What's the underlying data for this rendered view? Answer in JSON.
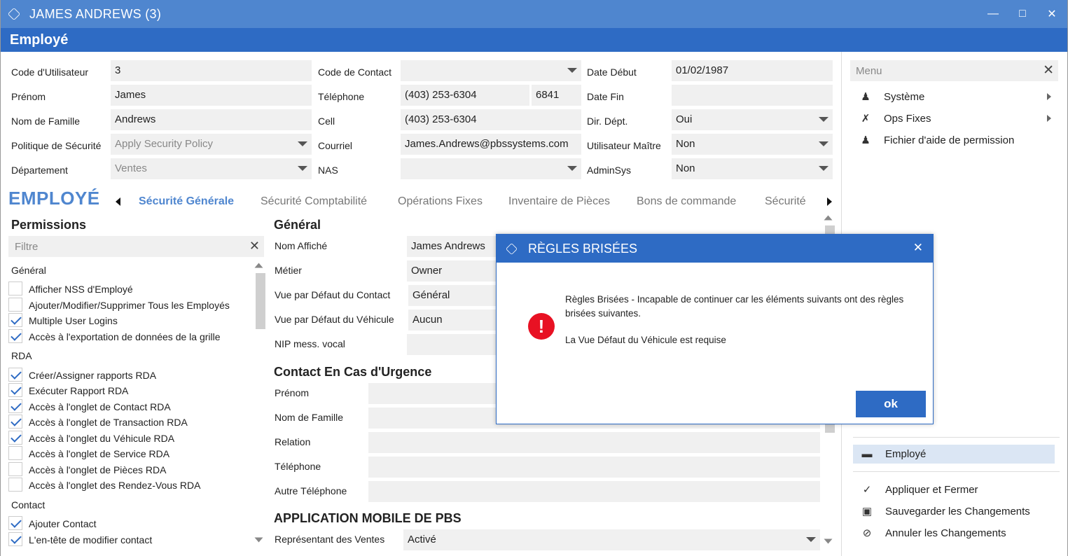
{
  "window": {
    "title": "JAMES ANDREWS (3)",
    "subtitle": "Employé"
  },
  "form": {
    "code_utilisateur": {
      "label": "Code d'Utilisateur",
      "value": "3"
    },
    "prenom": {
      "label": "Prénom",
      "value": "James"
    },
    "nom_famille": {
      "label": "Nom de Famille",
      "value": "Andrews"
    },
    "politique": {
      "label": "Politique de Sécurité",
      "value": "Apply Security Policy"
    },
    "departement": {
      "label": "Département",
      "value": "Ventes"
    },
    "code_contact": {
      "label": "Code de Contact",
      "value": ""
    },
    "telephone": {
      "label": "Téléphone",
      "value": "(403) 253-6304",
      "ext": "6841"
    },
    "cell": {
      "label": "Cell",
      "value": "(403) 253-6304"
    },
    "courriel": {
      "label": "Courriel",
      "value": "James.Andrews@pbssystems.com"
    },
    "nas": {
      "label": "NAS",
      "value": ""
    },
    "date_debut": {
      "label": "Date Début",
      "value": "01/02/1987"
    },
    "date_fin": {
      "label": "Date Fin",
      "value": ""
    },
    "dir_dept": {
      "label": "Dir. Dépt.",
      "value": "Oui"
    },
    "util_maitre": {
      "label": "Utilisateur Maître",
      "value": "Non"
    },
    "adminsys": {
      "label": "AdminSys",
      "value": "Non"
    }
  },
  "section_title": "EMPLOYÉ",
  "tabs": [
    "Sécurité Générale",
    "Sécurité Comptabilité",
    "Opérations Fixes",
    "Inventaire de Pièces",
    "Bons de commande",
    "Sécurité Ve"
  ],
  "permissions": {
    "title": "Permissions",
    "filter_placeholder": "Filtre",
    "groups": [
      {
        "name": "Général",
        "items": [
          {
            "label": "Afficher NSS d'Employé",
            "checked": false
          },
          {
            "label": "Ajouter/Modifier/Supprimer Tous les Employés",
            "checked": false
          },
          {
            "label": "Multiple User Logins",
            "checked": true
          },
          {
            "label": "Accès à l'exportation de données de la grille",
            "checked": true
          }
        ]
      },
      {
        "name": "RDA",
        "items": [
          {
            "label": "Créer/Assigner rapports RDA",
            "checked": true
          },
          {
            "label": "Exécuter Rapport RDA",
            "checked": true
          },
          {
            "label": "Accès à l'onglet de Contact RDA",
            "checked": true
          },
          {
            "label": "Accès à l'onglet de Transaction RDA",
            "checked": true
          },
          {
            "label": "Accès à l'onglet du Véhicule RDA",
            "checked": true
          },
          {
            "label": "Accès à l'onglet de Service RDA",
            "checked": false
          },
          {
            "label": "Accès à l'onglet de Pièces RDA",
            "checked": false
          },
          {
            "label": "Accès à l'onglet des Rendez-Vous RDA",
            "checked": false
          }
        ]
      },
      {
        "name": "Contact",
        "items": [
          {
            "label": "Ajouter Contact",
            "checked": true
          },
          {
            "label": "L'en-tête de modifier contact",
            "checked": true
          }
        ]
      }
    ]
  },
  "general": {
    "title": "Général",
    "nom_affiche": {
      "label": "Nom Affiché",
      "value": "James Andrews"
    },
    "metier": {
      "label": "Métier",
      "value": "Owner"
    },
    "vue_contact": {
      "label": "Vue par Défaut du Contact",
      "value": "Général"
    },
    "vue_vehicule": {
      "label": "Vue par Défaut du Véhicule",
      "value": "Aucun"
    },
    "nip": {
      "label": "NIP mess. vocal",
      "value": ""
    }
  },
  "urgence": {
    "title": "Contact En Cas d'Urgence",
    "fields": [
      "Prénom",
      "Nom de Famille",
      "Relation",
      "Téléphone",
      "Autre Téléphone"
    ]
  },
  "mobile": {
    "title": "APPLICATION MOBILE DE PBS",
    "rep_label": "Représentant des Ventes",
    "rep_value": "Activé"
  },
  "menu": {
    "placeholder": "Menu",
    "items": [
      "Système",
      "Ops Fixes",
      "Fichier d'aide de permission"
    ],
    "employe": "Employé",
    "actions": [
      "Appliquer et Fermer",
      "Sauvegarder les Changements",
      "Annuler les Changements"
    ]
  },
  "dialog": {
    "title": "RÈGLES BRISÉES",
    "message": "Règles Brisées - Incapable de continuer car les éléments suivants ont des règles brisées suivantes.",
    "detail": "La Vue Défaut du Véhicule est requise",
    "ok": "ok"
  },
  "colors": {
    "accent": "#2e6bc4",
    "titlebar": "#4f86cf",
    "error": "#e81123"
  }
}
